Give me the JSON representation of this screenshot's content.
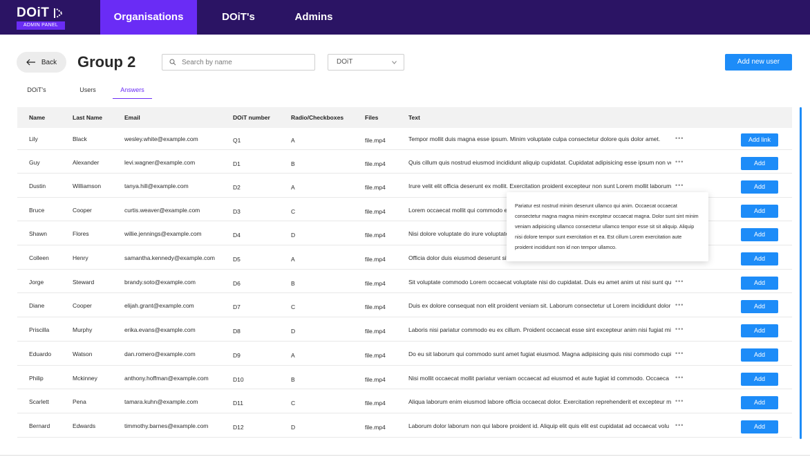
{
  "brand": {
    "name": "DOiT",
    "badge": "ADMIN PANEL"
  },
  "nav": {
    "tabs": [
      {
        "label": "Organisations"
      },
      {
        "label": "DOiT's"
      },
      {
        "label": "Admins"
      }
    ],
    "active": "Organisations"
  },
  "header": {
    "back_label": "Back",
    "title": "Group 2",
    "search_placeholder": "Search by name",
    "filter_value": "DOiT",
    "add_user_label": "Add new user"
  },
  "subtabs": {
    "items": [
      {
        "label": "DOiT's"
      },
      {
        "label": "Users"
      },
      {
        "label": "Answers"
      }
    ],
    "active": "Answers"
  },
  "table": {
    "columns": [
      "Name",
      "Last Name",
      "Email",
      "DOiT number",
      "Radio/Checkboxes",
      "Files",
      "Text"
    ],
    "rows": [
      {
        "name": "Lily",
        "last": "Black",
        "email": "wesley.white@example.com",
        "num": "Q1",
        "radio": "A",
        "file": "file.mp4",
        "text": "Tempor mollit duis magna esse ipsum. Minim voluptate culpa consectetur dolore quis dolor amet.",
        "action": "Add link"
      },
      {
        "name": "Guy",
        "last": "Alexander",
        "email": "levi.wagner@example.com",
        "num": "D1",
        "radio": "B",
        "file": "file.mp4",
        "text": "Quis cillum quis nostrud eiusmod incididunt aliquip cupidatat. Cupidatat adipisicing esse ipsum non veniam",
        "action": "Add"
      },
      {
        "name": "Dustin",
        "last": "Williamson",
        "email": "tanya.hill@example.com",
        "num": "D2",
        "radio": "A",
        "file": "file.mp4",
        "text": "Irure velit elit officia deserunt ex mollit. Exercitation proident excepteur non sunt Lorem mollit laborum irure.",
        "action": "Add"
      },
      {
        "name": "Bruce",
        "last": "Cooper",
        "email": "curtis.weaver@example.com",
        "num": "D3",
        "radio": "C",
        "file": "file.mp4",
        "text": "Lorem occaecat mollit qui commodo eiu",
        "action": "Add"
      },
      {
        "name": "Shawn",
        "last": "Flores",
        "email": "willie.jennings@example.com",
        "num": "D4",
        "radio": "D",
        "file": "file.mp4",
        "text": "Nisi dolore voluptate do irure voluptate n",
        "action": "Add"
      },
      {
        "name": "Colleen",
        "last": "Henry",
        "email": "samantha.kennedy@example.com",
        "num": "D5",
        "radio": "A",
        "file": "file.mp4",
        "text": "Officia dolor duis eiusmod deserunt sit. ",
        "action": "Add"
      },
      {
        "name": "Jorge",
        "last": "Steward",
        "email": "brandy.soto@example.com",
        "num": "D6",
        "radio": "B",
        "file": "file.mp4",
        "text": "Sit voluptate commodo Lorem occaecat voluptate nisi do cupidatat. Duis eu amet anim ut nisi sunt qu",
        "action": "Add"
      },
      {
        "name": "Diane",
        "last": "Cooper",
        "email": "elijah.grant@example.com",
        "num": "D7",
        "radio": "C",
        "file": "file.mp4",
        "text": "Duis ex dolore consequat non elit proident veniam sit. Laborum consectetur ut Lorem incididunt dolor est.",
        "action": "Add"
      },
      {
        "name": "Priscilla",
        "last": "Murphy",
        "email": "erika.evans@example.com",
        "num": "D8",
        "radio": "D",
        "file": "file.mp4",
        "text": "Laboris nisi pariatur commodo eu ex cillum. Proident occaecat esse sint excepteur anim nisi fugiat min",
        "action": "Add"
      },
      {
        "name": "Eduardo",
        "last": "Watson",
        "email": "dan.romero@example.com",
        "num": "D9",
        "radio": "A",
        "file": "file.mp4",
        "text": "Do eu sit laborum qui commodo sunt amet fugiat eiusmod. Magna adipisicing quis nisi commodo cupi",
        "action": "Add"
      },
      {
        "name": "Philip",
        "last": "Mckinney",
        "email": "anthony.hoffman@example.com",
        "num": "D10",
        "radio": "B",
        "file": "file.mp4",
        "text": "Nisi mollit occaecat mollit pariatur veniam occaecat ad eiusmod et aute fugiat id commodo. Occaeca",
        "action": "Add"
      },
      {
        "name": "Scarlett",
        "last": "Pena",
        "email": "tamara.kuhn@example.com",
        "num": "D11",
        "radio": "C",
        "file": "file.mp4",
        "text": "Aliqua laborum enim eiusmod labore officia occaecat dolor. Exercitation reprehenderit et excepteur mi",
        "action": "Add"
      },
      {
        "name": "Bernard",
        "last": "Edwards",
        "email": "timmothy.barnes@example.com",
        "num": "D12",
        "radio": "D",
        "file": "file.mp4",
        "text": "Laborum dolor laborum non qui labore proident id. Aliquip elit quis elit est cupidatat ad occaecat volu",
        "action": "Add"
      }
    ]
  },
  "popover": {
    "text": "Pariatur est nostrud minim deserunt ullamco qui anim. Occaecat occaecat consectetur magna magna minim excepteur occaecat magna. Dolor sunt sint minim veniam adipisicing ullamco consectetur ullamco tempor esse sit sit aliquip. Aliquip nisi dolore tempor sunt exercitation et ea. Est cillum Lorem exercitation aute proident incididunt non id non tempor ullamco."
  },
  "colors": {
    "nav_bg": "#2b1464",
    "accent": "#6a2cf5",
    "primary": "#1d8cf8"
  },
  "icons": {
    "back": "arrow-left-icon",
    "search": "search-icon",
    "dropdown": "chevron-down-icon",
    "more": "more-horizontal-icon"
  }
}
